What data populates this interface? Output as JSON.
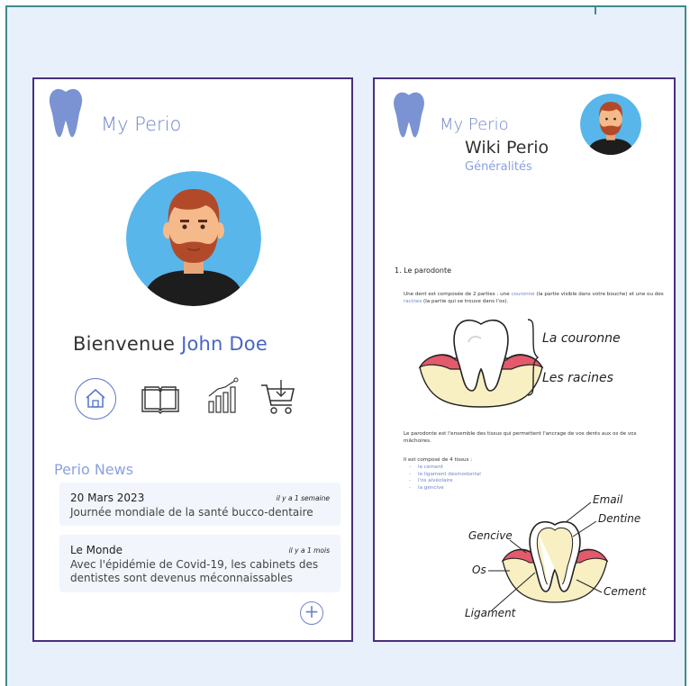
{
  "app": {
    "brand": "My Perio"
  },
  "home": {
    "welcome_prefix": "Bienvenue",
    "user_name": "John Doe",
    "nav": [
      {
        "icon": "home-icon"
      },
      {
        "icon": "book-icon"
      },
      {
        "icon": "chart-icon"
      },
      {
        "icon": "cart-download-icon"
      }
    ],
    "news_title": "Perio News",
    "news": [
      {
        "source": "20 Mars 2023",
        "time": "il y a 1 semaine",
        "lines": [
          "Journée mondiale de la santé bucco-dentaire"
        ]
      },
      {
        "source": "Le Monde",
        "time": "il y a 1 mois",
        "lines": [
          "Avec l'épidémie de Covid-19, les cabinets des",
          "dentistes sont devenus méconnaissables"
        ]
      }
    ],
    "add_label": "+"
  },
  "wiki": {
    "title": "Wiki Perio",
    "subtitle": "Généralités",
    "section_heading": "1.   Le parodonte",
    "intro_parts": {
      "a": "Une dent est composée de 2 parties : une ",
      "b": "couronne",
      "c": " (la partie visible dans votre bouche) et une ou des ",
      "d": "racines",
      "e": " (la partie qui se trouve dans l'os)."
    },
    "tooth_labels": {
      "crown": "La couronne",
      "roots": "Les racines"
    },
    "paragraph": "Le parodonte est l'ensemble des tissus qui permettent l'ancrage de vos dents aux os de vos mâchoires.",
    "tissues_intro": "Il est composé de 4 tissus :",
    "tissues": [
      "le cément",
      "le ligament desmodontal",
      "l'os alvéolaire",
      "la gencive"
    ],
    "anatomy_labels": {
      "email": "Email",
      "dentine": "Dentine",
      "gencive": "Gencive",
      "os": "Os",
      "cement": "Cement",
      "ligament": "Ligament"
    }
  },
  "colors": {
    "frame_border": "#3f8a8c",
    "background": "#e8f0fb",
    "phone_border": "#4a2e7c",
    "brand_blue": "#6f86c9",
    "name_blue": "#4865c6",
    "avatar_bg": "#58b6ea",
    "hair": "#b24a2a",
    "skin": "#f6b98a",
    "gum": "#e25a6c",
    "bone": "#f8efc2"
  }
}
